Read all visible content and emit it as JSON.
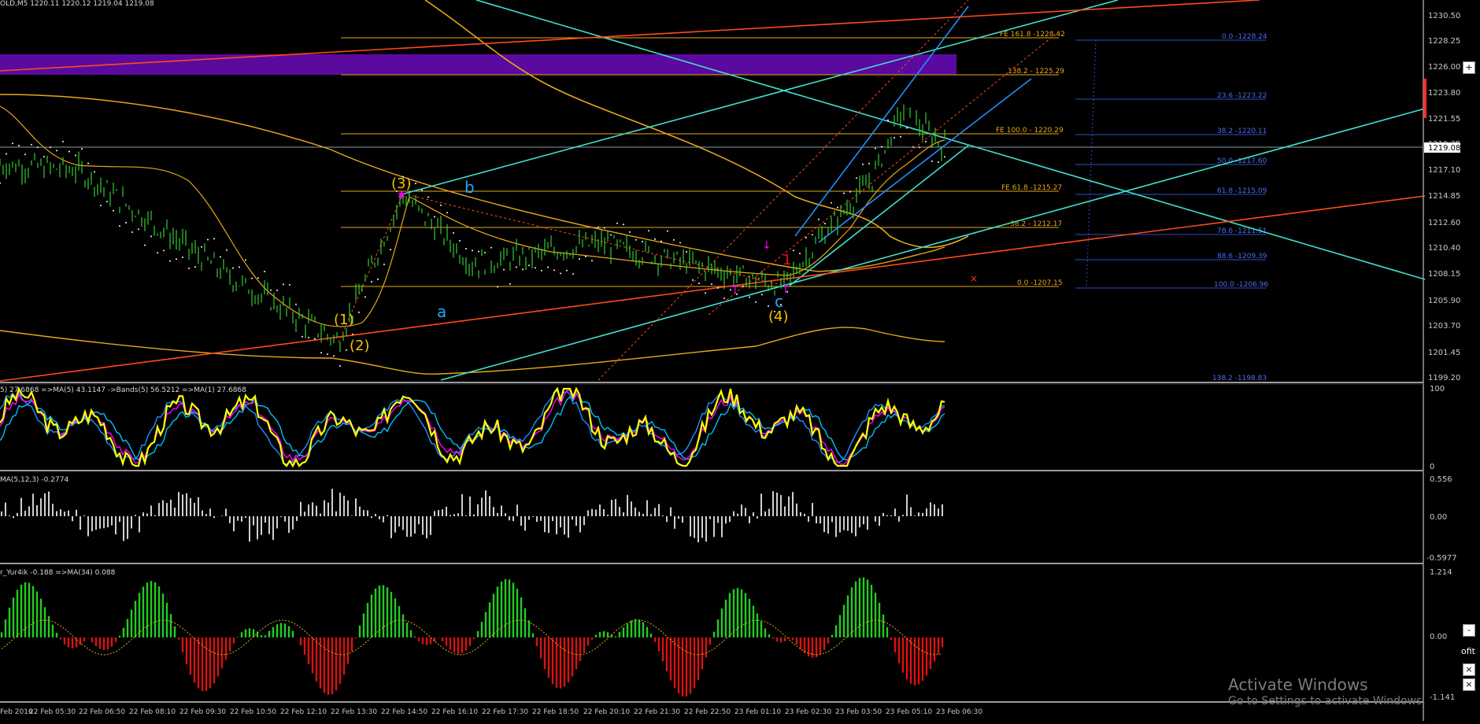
{
  "window": {
    "symbol_header": "OLD,M5  1220.11 1220.12 1219.04 1219.08",
    "current_price_tag": "1219.08"
  },
  "price_axis": {
    "ticks": [
      "1230.50",
      "1228.25",
      "1226.00",
      "1223.80",
      "1221.55",
      "1219.35",
      "1217.10",
      "1214.85",
      "1212.60",
      "1210.40",
      "1208.15",
      "1205.90",
      "1203.70",
      "1201.45",
      "1199.20"
    ],
    "ylim": [
      1199.2,
      1230.5
    ]
  },
  "time_axis": {
    "ticks": [
      "Feb 2016",
      "22 Feb 05:30",
      "22 Feb 06:50",
      "22 Feb 08:10",
      "22 Feb 09:30",
      "22 Feb 10:50",
      "22 Feb 12:10",
      "22 Feb 13:30",
      "22 Feb 14:50",
      "22 Feb 16:10",
      "22 Feb 17:30",
      "22 Feb 18:50",
      "22 Feb 20:10",
      "22 Feb 21:30",
      "22 Feb 22:50",
      "23 Feb 01:10",
      "23 Feb 02:30",
      "23 Feb 03:50",
      "23 Feb 05:10",
      "23 Feb 06:30"
    ]
  },
  "fib_expansion_labels": [
    "FE 161.8 -1228.42",
    "138.2 - 1225.29",
    "FE 100.0 - 1220.29",
    "FE 61.8 -1215.27",
    "38.2 - 1212.17",
    "0.0 -1207.15"
  ],
  "fib_retracement_labels": [
    "0.0 -1228.24",
    "23.6 -1223.22",
    "38.2 -1220.11",
    "50.0 -1217.60",
    "61.8 -1215.09",
    "78.6 -1211.51",
    "88.6 -1209.39",
    "100.0 -1206.96",
    "138.2 -1198.83"
  ],
  "wave_labels": {
    "w1": "(1)",
    "w2": "(2)",
    "w3": "(3)",
    "w4": "(4)",
    "a": "a",
    "b": "b",
    "c": "c",
    "one": "1"
  },
  "colors": {
    "background": "#000000",
    "gridline": "#1a1a1a",
    "candle": "#32cd32",
    "cyan_line": "#40e0d0",
    "orange_line": "#ff4a1a",
    "gold": "#e6a817",
    "purple_zone": "#5b0aa0",
    "fib_blue": "#2e50c8",
    "volume_up": "#22cc22",
    "volume_down": "#dd1111",
    "stoch_yellow": "#ffff00",
    "stoch_blue": "#1e90ff",
    "stoch_cyan": "#00bfff",
    "stoch_magenta": "#ff00ff"
  },
  "indicator1": {
    "header": "5) 27.6868  =>MA(5) 43.1147  ->Bands(5) 56.5212  =>MA(1) 27.6868",
    "scale": [
      "100",
      "0"
    ]
  },
  "indicator2": {
    "header": "MA(5,12,3) -0.2774",
    "scale": [
      "0.556",
      "0.00",
      "-0.5977"
    ]
  },
  "indicator3": {
    "header": "r_Yur4ik -0.188  =>MA(34) 0.088",
    "scale": [
      "1.214",
      "0.00",
      "-1.141"
    ]
  },
  "side_buttons": [
    "+",
    "-",
    "×",
    "×"
  ],
  "side_text": "ofit",
  "watermark": {
    "title": "Activate Windows",
    "subtitle": "Go to Settings to activate Windows."
  },
  "chart_data": {
    "type": "line",
    "title": "",
    "xlabel": "",
    "ylabel": "",
    "ylim": [
      1199.2,
      1230.5
    ],
    "x": [
      "22 Feb 05:30",
      "22 Feb 08:10",
      "22 Feb 10:50",
      "22 Feb 13:30",
      "22 Feb 14:50",
      "22 Feb 16:10",
      "22 Feb 18:50",
      "22 Feb 21:30",
      "23 Feb 01:10",
      "23 Feb 02:30",
      "23 Feb 03:50",
      "23 Feb 05:10",
      "23 Feb 06:30"
    ],
    "series": [
      {
        "values": [
          1217.5,
          1217.0,
          1208.0,
          1202.5,
          1214.9,
          1209.0,
          1210.8,
          1208.7,
          1207.2,
          1211.0,
          1216.5,
          1222.0,
          1219.08
        ]
      }
    ],
    "grid": false
  }
}
